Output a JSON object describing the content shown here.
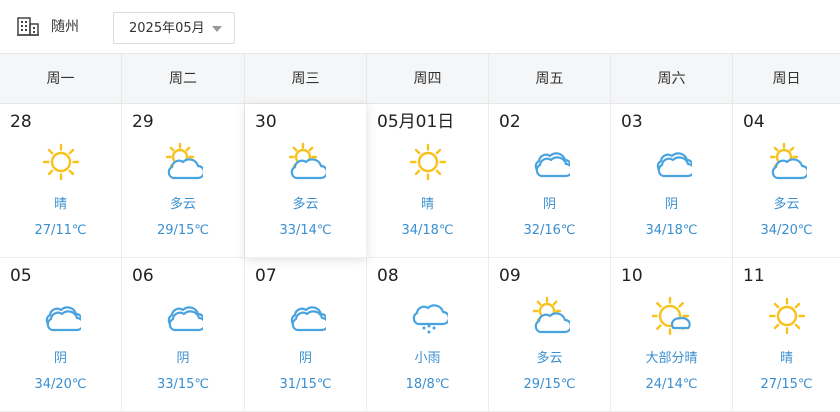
{
  "header": {
    "city": "随州",
    "month_selector": {
      "selected": "2025年05月"
    }
  },
  "weekdays": [
    "周一",
    "周二",
    "周三",
    "周四",
    "周五",
    "周六",
    "周日"
  ],
  "colors": {
    "sun": "#f8c21c",
    "cloud": "#4aa3df",
    "text_blue": "#3a8fd0",
    "header_bg": "#f5f6f7"
  },
  "days": [
    {
      "date": "28",
      "icon": "sunny-icon",
      "condition": "晴",
      "temp": "27/11℃"
    },
    {
      "date": "29",
      "icon": "partly-cloudy-icon",
      "condition": "多云",
      "temp": "29/15℃"
    },
    {
      "date": "30",
      "icon": "partly-cloudy-icon",
      "condition": "多云",
      "temp": "33/14℃",
      "active": true
    },
    {
      "date": "05月01日",
      "icon": "sunny-icon",
      "condition": "晴",
      "temp": "34/18℃"
    },
    {
      "date": "02",
      "icon": "cloudy-icon",
      "condition": "阴",
      "temp": "32/16℃"
    },
    {
      "date": "03",
      "icon": "cloudy-icon",
      "condition": "阴",
      "temp": "34/18℃"
    },
    {
      "date": "04",
      "icon": "partly-cloudy-icon",
      "condition": "多云",
      "temp": "34/20℃"
    },
    {
      "date": "05",
      "icon": "cloudy-icon",
      "condition": "阴",
      "temp": "34/20℃"
    },
    {
      "date": "06",
      "icon": "cloudy-icon",
      "condition": "阴",
      "temp": "33/15℃"
    },
    {
      "date": "07",
      "icon": "cloudy-icon",
      "condition": "阴",
      "temp": "31/15℃"
    },
    {
      "date": "08",
      "icon": "light-rain-icon",
      "condition": "小雨",
      "temp": "18/8℃"
    },
    {
      "date": "09",
      "icon": "partly-cloudy-icon",
      "condition": "多云",
      "temp": "29/15℃"
    },
    {
      "date": "10",
      "icon": "mostly-sunny-icon",
      "condition": "大部分晴",
      "temp": "24/14℃"
    },
    {
      "date": "11",
      "icon": "sunny-icon",
      "condition": "晴",
      "temp": "27/15℃"
    }
  ]
}
